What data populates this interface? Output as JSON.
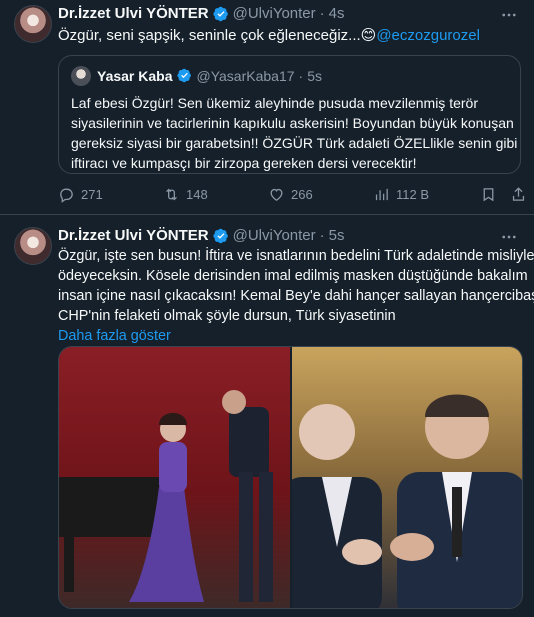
{
  "colors": {
    "background": "#15202b",
    "text": "#f7f9f9",
    "muted": "#8b98a5",
    "link": "#1d9bf0",
    "border": "#38444d"
  },
  "tweet1": {
    "name": "Dr.İzzet Ulvi YÖNTER",
    "handle": "@UlviYonter",
    "time": "4s",
    "text": "Özgür, seni şapşik, seninle çok eğleneceğiz...",
    "emoji": "😊",
    "mention": "@eczozgurozel",
    "quote": {
      "name": "Yasar Kaba",
      "handle": "@YasarKaba17",
      "time": "5s",
      "lines": [
        "Laf ebesi Özgür! Sen ükemiz aleyhinde pusuda mevzilenmiş terör",
        "siyasilerinin ve tacirlerinin kapıkulu askerisin! Boyundan büyük konuşan",
        "gereksiz siyasi bir garabetsin!! ÖZGÜR Türk adaleti ÖZELlikle senin gibi",
        "iftiracı ve kumpasçı bir zirzopa gereken dersi verecektir!"
      ]
    },
    "actions": {
      "replies": "271",
      "retweets": "148",
      "likes": "266",
      "views": "112 B"
    }
  },
  "tweet2": {
    "name": "Dr.İzzet Ulvi YÖNTER",
    "handle": "@UlviYonter",
    "time": "5s",
    "lines": [
      "Özgür, işte sen busun! İftira ve isnatlarının bedelini Türk adaletinde misliyle",
      "ödeyeceksin. Kösele derisinden imal edilmiş masken düştüğünde bakalım",
      "insan içine nasıl çıkacaksın! Kemal Bey'e dahi hançer sallayan hançercibaşı,",
      "CHP'nin felaketi olmak şöyle dursun, Türk siyasetinin"
    ],
    "show_more": "Daha fazla göster"
  },
  "icons": [
    "verified-badge-icon",
    "more-icon",
    "reply-icon",
    "retweet-icon",
    "like-icon",
    "views-icon",
    "bookmark-icon",
    "share-icon"
  ]
}
